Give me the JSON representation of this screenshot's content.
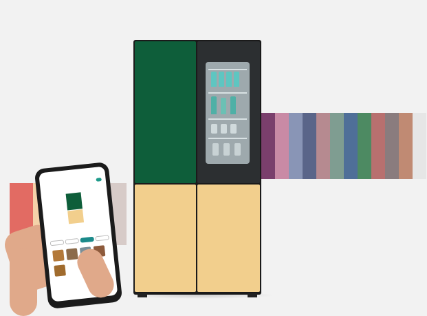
{
  "scene": {
    "subject": "",
    "colors": {
      "background": "#f2f2f2",
      "door_top_left": "#0e5e3a",
      "door_top_right": "#2c2f31",
      "door_bottom": "#f2cf8d",
      "phone_accent": "#1e9a8a"
    },
    "right_stripe_colors": [
      "#7a3f6c",
      "#c98aa5",
      "#8995b6",
      "#5a6589",
      "#b68a90",
      "#7f9d91",
      "#4f6f98",
      "#4d8a62",
      "#b8706f",
      "#8a7c7e",
      "#c08a73",
      "#e6e6e6"
    ],
    "left_stripe_colors": [
      "#e26b63",
      "#f4d2a9",
      "#f7d7b6",
      "#efe3cf",
      "#d7cbc8"
    ]
  },
  "phone": {
    "app_title": "",
    "status_left": "",
    "status_right": "",
    "chips": [
      "",
      "",
      "",
      ""
    ],
    "thumbnail_colors": [
      "#b3793a",
      "#8c6b4a",
      "#7a8f98",
      "#8d5a3b",
      "#a06b2d"
    ]
  }
}
